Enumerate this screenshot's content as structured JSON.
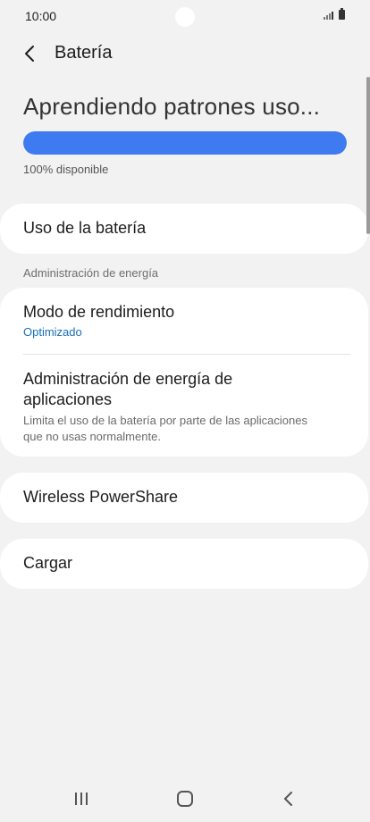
{
  "status_bar": {
    "time": "10:00"
  },
  "header": {
    "title": "Batería"
  },
  "battery": {
    "status_title": "Aprendiendo patrones uso...",
    "progress_percent": 100,
    "available_text": "100% disponible"
  },
  "items": {
    "battery_usage": "Uso de la batería",
    "section_header": "Administración de energía",
    "performance_mode": {
      "title": "Modo de rendimiento",
      "value": "Optimizado"
    },
    "app_power": {
      "title_line1": "Administración de energía de",
      "title_line2": "aplicaciones",
      "desc_line1": "Limita el uso de la batería por parte de las aplicaciones",
      "desc_line2": "que no usas normalmente."
    },
    "wireless_powershare": "Wireless PowerShare",
    "charging": "Cargar"
  },
  "colors": {
    "background": "#f2f2f2",
    "progress_fill": "#3e7bf0",
    "accent_text": "#1a6fb5"
  },
  "icons": [
    "back-arrow-icon",
    "signal-icon",
    "battery-icon",
    "recent-apps-icon",
    "home-icon",
    "back-icon"
  ]
}
